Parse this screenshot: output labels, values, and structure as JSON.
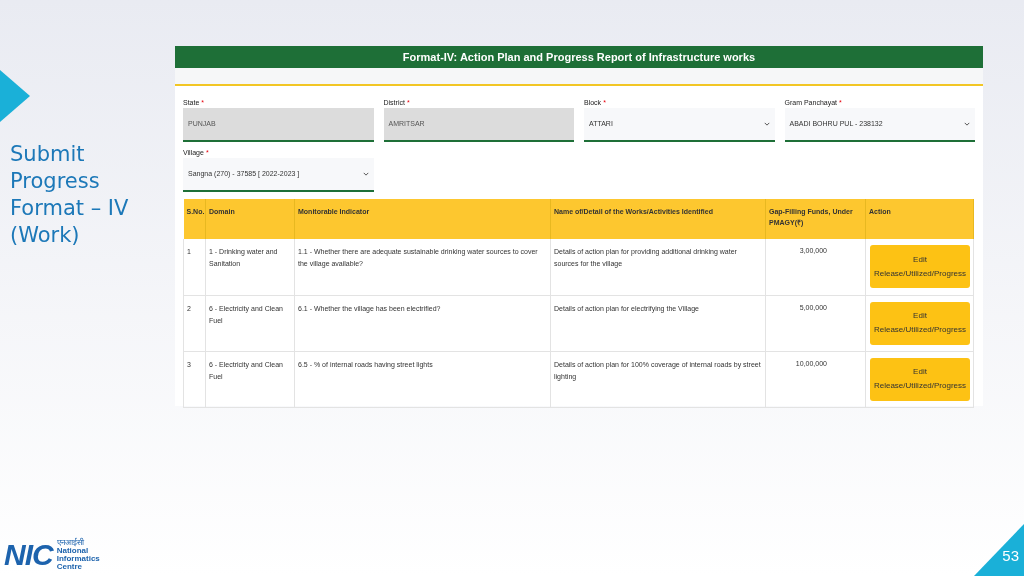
{
  "slide": {
    "title": "Submit Progress Format – IV (Work)",
    "page_number": "53"
  },
  "form": {
    "title": "Format-IV: Action Plan and Progress Report of Infrastructure works",
    "fields": [
      {
        "label": "State",
        "required_mark": "*",
        "value": "PUNJAB",
        "disabled": true
      },
      {
        "label": "District",
        "required_mark": "*",
        "value": "AMRITSAR",
        "disabled": true
      },
      {
        "label": "Block",
        "required_mark": "*",
        "value": "ATTARI",
        "disabled": false
      },
      {
        "label": "Gram Panchayat",
        "required_mark": "*",
        "value": "ABADI BOHRU PUL - 238132",
        "disabled": false
      },
      {
        "label": "Village",
        "required_mark": "*",
        "value": "Sangna (270) - 37585 [ 2022-2023 ]",
        "disabled": false
      }
    ]
  },
  "table": {
    "columns": [
      "S.No.",
      "Domain",
      "Monitorable Indicator",
      "Name of/Detail of the Works/Activities Identified",
      "Gap-Filling Funds, Under PMAGY(₹)",
      "Action"
    ],
    "rows": [
      {
        "sno": "1",
        "domain": "1 - Drinking water and Sanitation",
        "indicator": "1.1 - Whether there are adequate sustainable drinking water sources to cover the village available?",
        "detail": "Details of action plan for providing additional drinking water sources for the village",
        "funds": "3,00,000",
        "action": "Edit Release/Utilized/Progress"
      },
      {
        "sno": "2",
        "domain": "6 - Electricity and Clean Fuel",
        "indicator": "6.1 - Whether the village has been electrified?",
        "detail": "Details of action plan for electrifying the Village",
        "funds": "5,00,000",
        "action": "Edit Release/Utilized/Progress"
      },
      {
        "sno": "3",
        "domain": "6 - Electricity and Clean Fuel",
        "indicator": "6.5 - % of internal roads having street lights",
        "detail": "Details of action plan for 100% coverage of internal roads by street lighting",
        "funds": "10,00,000",
        "action": "Edit Release/Utilized/Progress"
      }
    ]
  },
  "logo": {
    "mark": "NIC",
    "hindi": "एनआईसी",
    "name": "National Informatics Centre"
  }
}
